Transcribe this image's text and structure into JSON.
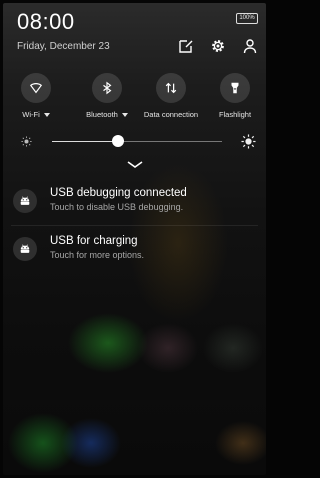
{
  "status": {
    "time": "08:00",
    "battery": "100%"
  },
  "header": {
    "date": "Friday, December 23"
  },
  "quick_settings": [
    {
      "label": "Wi-Fi",
      "icon": "wifi-icon",
      "has_dropdown": true
    },
    {
      "label": "Bluetooth",
      "icon": "bluetooth-icon",
      "has_dropdown": true
    },
    {
      "label": "Data connection",
      "icon": "data-connection-icon",
      "has_dropdown": false
    },
    {
      "label": "Flashlight",
      "icon": "flashlight-icon",
      "has_dropdown": false
    }
  ],
  "brightness": {
    "level": 0.39
  },
  "notifications": [
    {
      "title": "USB debugging connected",
      "subtitle": "Touch to disable USB debugging.",
      "icon": "android-icon"
    },
    {
      "title": "USB for charging",
      "subtitle": "Touch for more options.",
      "icon": "android-icon"
    }
  ]
}
